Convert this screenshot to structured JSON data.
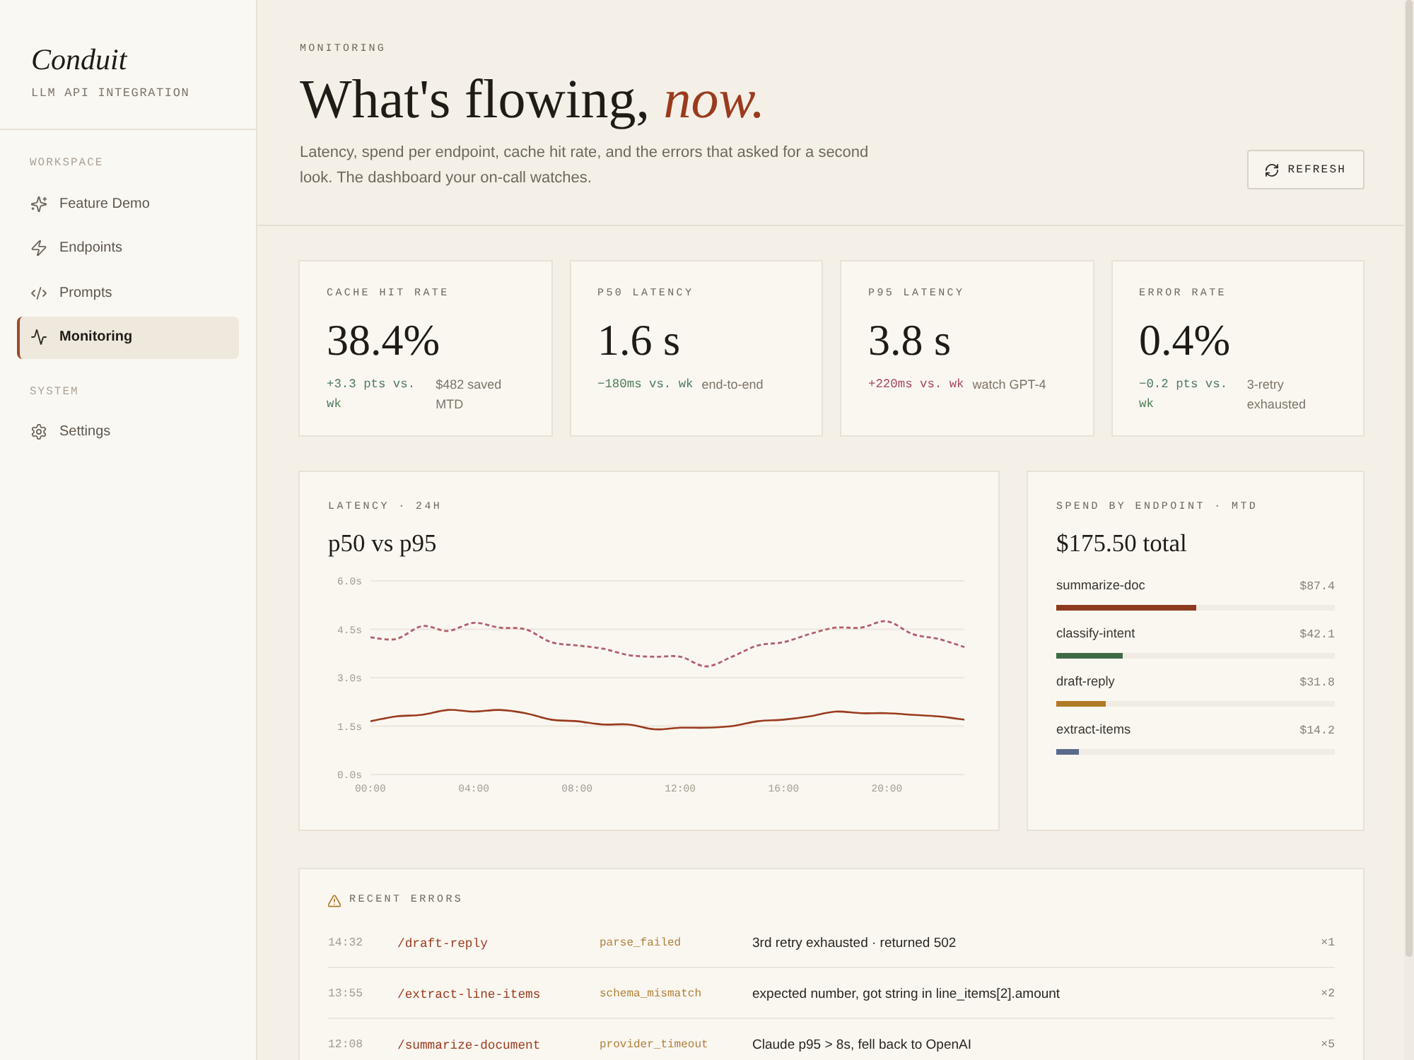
{
  "sidebar": {
    "brand": {
      "name": "Conduit",
      "tagline": "LLM API INTEGRATION"
    },
    "sections": [
      {
        "label": "WORKSPACE",
        "items": [
          {
            "label": "Feature Demo",
            "selected": false
          },
          {
            "label": "Endpoints",
            "selected": false
          },
          {
            "label": "Prompts",
            "selected": false
          },
          {
            "label": "Monitoring",
            "selected": true
          }
        ]
      },
      {
        "label": "SYSTEM",
        "items": [
          {
            "label": "Settings",
            "selected": false
          }
        ]
      }
    ]
  },
  "header": {
    "eyebrow": "MONITORING",
    "title": "What's flowing, *now.*",
    "description": "Latency, spend per endpoint, cache hit rate, and the errors that asked for a second look. The dashboard your on-call watches.",
    "refresh_button": "REFRESH"
  },
  "metrics": [
    {
      "label": "CACHE HIT RATE",
      "value": "38.4%",
      "delta": "+3.3 pts vs. wk",
      "regression": false,
      "note": "$482 saved MTD"
    },
    {
      "label": "P50 LATENCY",
      "value": "1.6 s",
      "delta": "−180ms vs. wk",
      "regression": false,
      "note": "end-to-end"
    },
    {
      "label": "P95 LATENCY",
      "value": "3.8 s",
      "delta": "+220ms vs. wk",
      "regression": true,
      "note": "watch GPT-4"
    },
    {
      "label": "ERROR RATE",
      "value": "0.4%",
      "delta": "−0.2 pts vs. wk",
      "regression": false,
      "note": "3-retry exhausted"
    }
  ],
  "latency_panel": {
    "label": "LATENCY · 24H",
    "chart_data": {
      "type": "line",
      "title": "p50 vs p95",
      "x": [
        0,
        1,
        2,
        3,
        4,
        5,
        6,
        7,
        8,
        9,
        10,
        11,
        12,
        13,
        14,
        15,
        16,
        17,
        18,
        19,
        20,
        21,
        22,
        23
      ],
      "xlim": [
        0,
        23
      ],
      "ylim": [
        0,
        6
      ],
      "xticks": [
        {
          "value": 0,
          "label": "00:00"
        },
        {
          "value": 4,
          "label": "04:00"
        },
        {
          "value": 8,
          "label": "08:00"
        },
        {
          "value": 12,
          "label": "12:00"
        },
        {
          "value": 16,
          "label": "16:00"
        },
        {
          "value": 20,
          "label": "20:00"
        }
      ],
      "yticks": [
        {
          "value": 0,
          "label": "0.0s"
        },
        {
          "value": 1.5,
          "label": "1.5s"
        },
        {
          "value": 3,
          "label": "3.0s"
        },
        {
          "value": 4.5,
          "label": "4.5s"
        },
        {
          "value": 6,
          "label": "6.0s"
        }
      ],
      "grid": true,
      "series": [
        {
          "color": "#9a3b1e",
          "values": [
            1.65,
            1.8,
            1.85,
            2.0,
            1.95,
            2.0,
            1.9,
            1.7,
            1.65,
            1.55,
            1.55,
            1.4,
            1.45,
            1.45,
            1.5,
            1.65,
            1.7,
            1.8,
            1.95,
            1.9,
            1.9,
            1.85,
            1.8,
            1.7
          ]
        },
        {
          "color": "#b35f6b",
          "line_style": "dashed",
          "values": [
            4.25,
            4.2,
            4.6,
            4.45,
            4.7,
            4.55,
            4.5,
            4.1,
            4.0,
            3.9,
            3.7,
            3.65,
            3.65,
            3.35,
            3.65,
            4.0,
            4.1,
            4.35,
            4.55,
            4.55,
            4.75,
            4.35,
            4.2,
            3.95
          ]
        }
      ]
    }
  },
  "spend_panel": {
    "label": "SPEND BY ENDPOINT · MTD",
    "total": "$175.50 total",
    "endpoints": [
      {
        "name": "summarize-doc",
        "amount": "$87.4",
        "level": 0.5,
        "color": "#8e3a1f"
      },
      {
        "name": "classify-intent",
        "amount": "$42.1",
        "level": 0.24,
        "color": "#3e6b46"
      },
      {
        "name": "draft-reply",
        "amount": "$31.8",
        "level": 0.18,
        "color": "#b07a25"
      },
      {
        "name": "extract-items",
        "amount": "$14.2",
        "level": 0.08,
        "color": "#5a6a8a"
      }
    ]
  },
  "recent_errors": {
    "label": "RECENT ERRORS",
    "rows": [
      {
        "time": "14:32",
        "endpoint": "/draft-reply",
        "code": "parse_failed",
        "message": "3rd retry exhausted · returned 502",
        "count": "×1"
      },
      {
        "time": "13:55",
        "endpoint": "/extract-line-items",
        "code": "schema_mismatch",
        "message": "expected number, got string in line_items[2].amount",
        "count": "×2"
      },
      {
        "time": "12:08",
        "endpoint": "/summarize-document",
        "code": "provider_timeout",
        "message": "Claude p95 > 8s, fell back to OpenAI",
        "count": "×5"
      }
    ]
  }
}
